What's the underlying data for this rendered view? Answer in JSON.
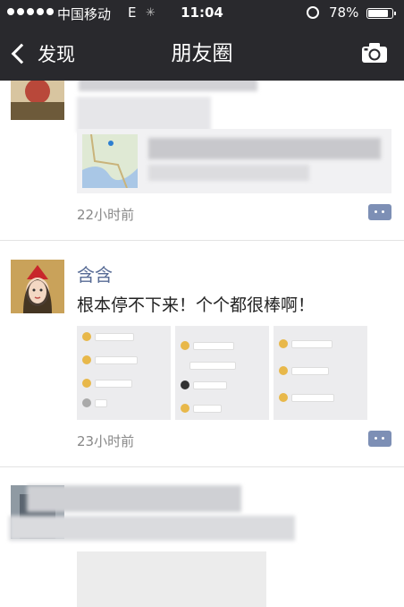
{
  "status_bar": {
    "carrier": "中国移动",
    "network": "E",
    "time": "11:04",
    "battery": "78%",
    "battery_level": 0.78
  },
  "navbar": {
    "back_label": "发现",
    "title": "朋友圈"
  },
  "posts": [
    {
      "time": "22小时前"
    },
    {
      "name": "含含",
      "text": "根本停不下来！个个都很棒啊！",
      "time": "23小时前"
    }
  ],
  "colors": {
    "bar_bg": "#29292d",
    "name_link": "#576b95",
    "comment_btn": "#7d8fb5"
  }
}
